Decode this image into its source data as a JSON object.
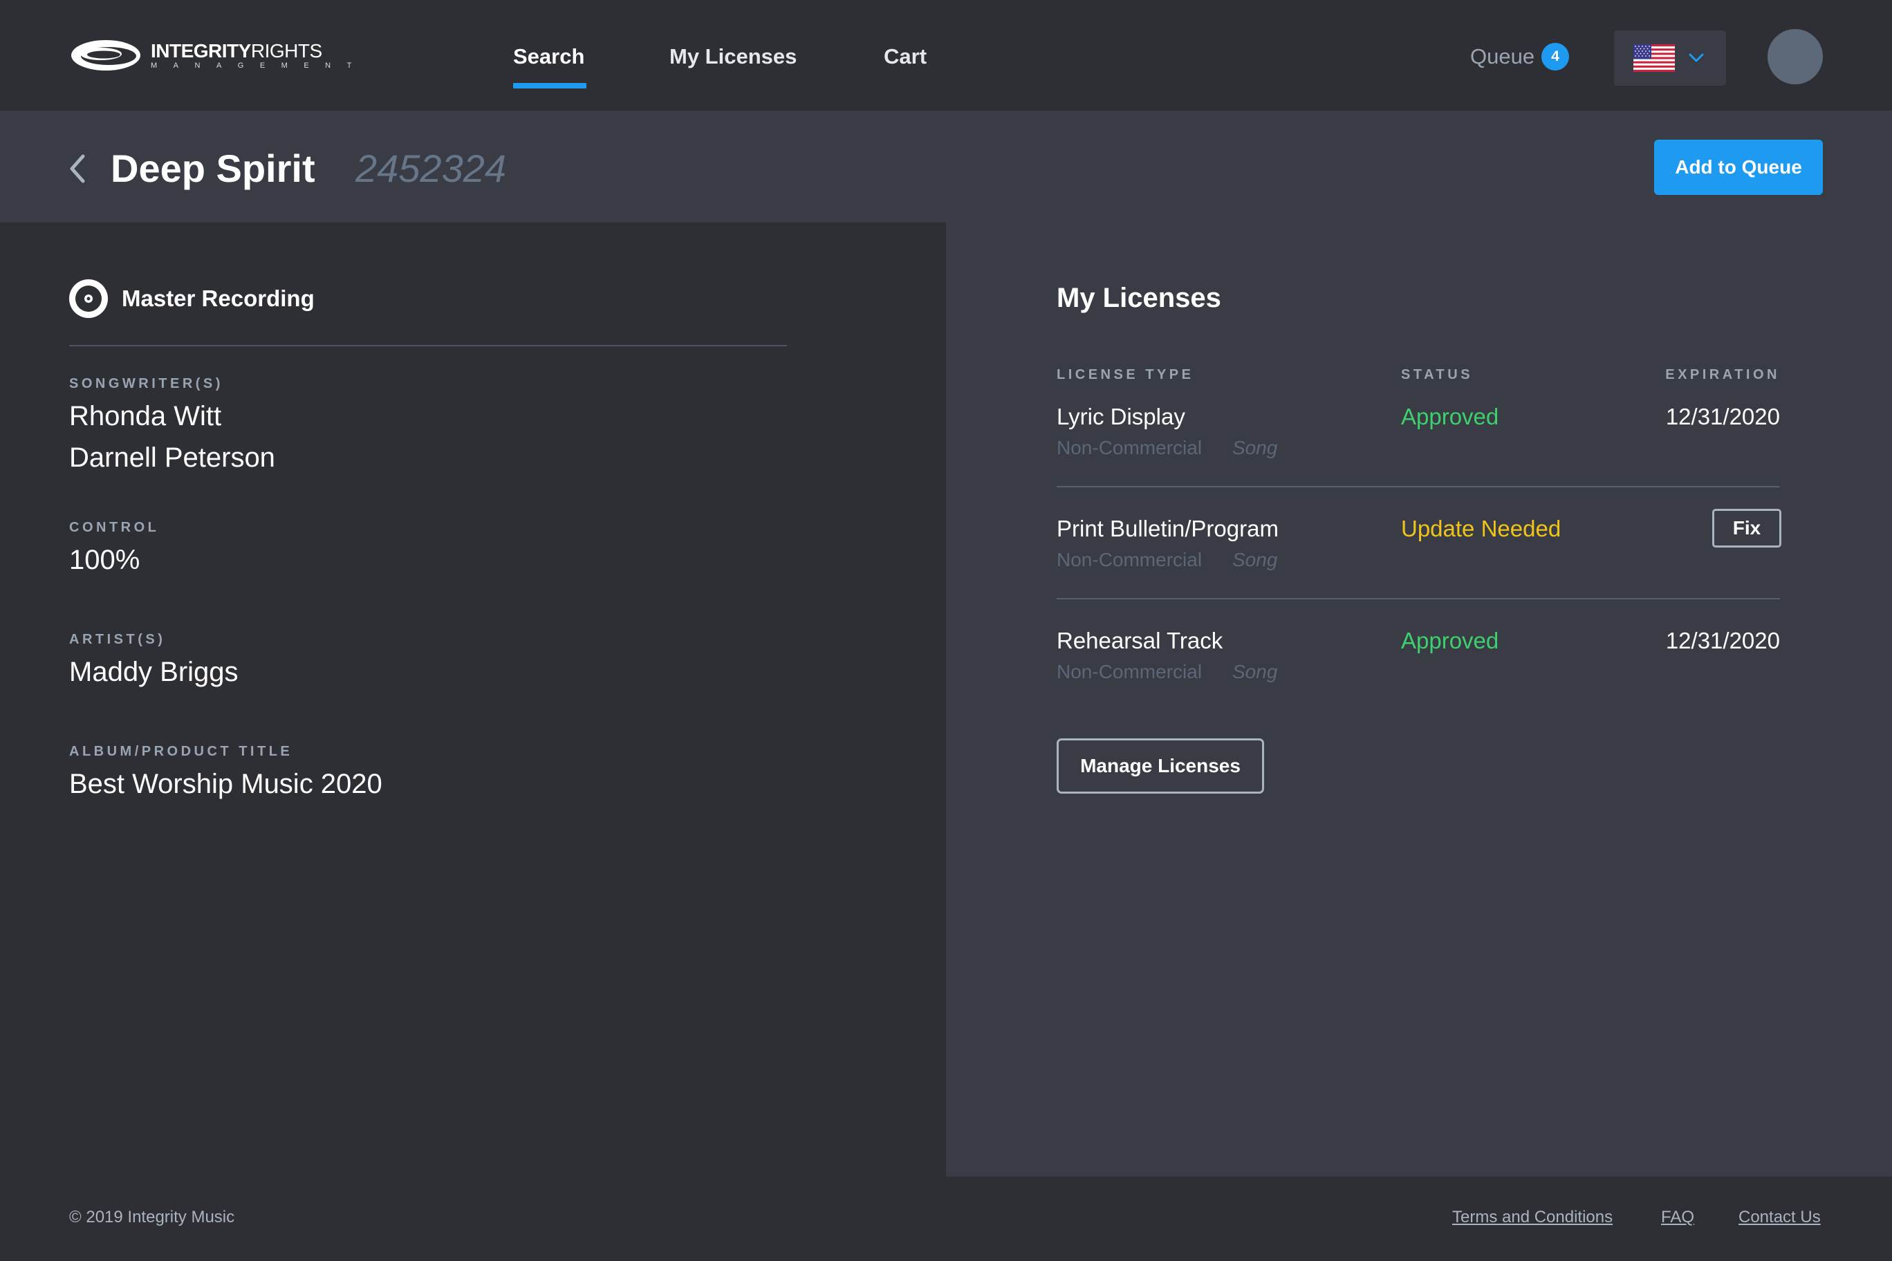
{
  "brand": {
    "logo_bold": "INTEGRITY",
    "logo_regular": "RIGHTS",
    "logo_sub": "MANAGEMENT"
  },
  "nav": {
    "search": "Search",
    "my_licenses": "My Licenses",
    "cart": "Cart",
    "active": "Search"
  },
  "header": {
    "queue_label": "Queue",
    "queue_count": "4",
    "language_flag": "us-flag-icon",
    "accent_color": "#1e9af0"
  },
  "title_bar": {
    "song_title": "Deep Spirit",
    "song_id": "2452324",
    "add_to_queue": "Add to Queue"
  },
  "recording": {
    "type_label": "Master Recording",
    "songwriters_label": "SONGWRITER(S)",
    "songwriters": [
      "Rhonda Witt",
      "Darnell Peterson"
    ],
    "control_label": "CONTROL",
    "control": "100%",
    "artists_label": "ARTIST(S)",
    "artist": "Maddy Briggs",
    "album_label": "ALBUM/PRODUCT TITLE",
    "album": "Best Worship Music 2020"
  },
  "licenses": {
    "title": "My Licenses",
    "columns": {
      "type": "LICENSE TYPE",
      "status": "STATUS",
      "expiration": "EXPIRATION"
    },
    "rows": [
      {
        "type": "Lyric Display",
        "scope": "Non-Commercial",
        "kind": "Song",
        "status": "Approved",
        "status_color": "#3ecf6e",
        "expiration": "12/31/2020"
      },
      {
        "type": "Print Bulletin/Program",
        "scope": "Non-Commercial",
        "kind": "Song",
        "status": "Update Needed",
        "status_color": "#f0c419",
        "action": "Fix"
      },
      {
        "type": "Rehearsal Track",
        "scope": "Non-Commercial",
        "kind": "Song",
        "status": "Approved",
        "status_color": "#3ecf6e",
        "expiration": "12/31/2020"
      }
    ],
    "manage_button": "Manage Licenses"
  },
  "footer": {
    "copyright": "© 2019 Integrity Music",
    "links": [
      "Terms and Conditions",
      "FAQ",
      "Contact Us"
    ]
  }
}
